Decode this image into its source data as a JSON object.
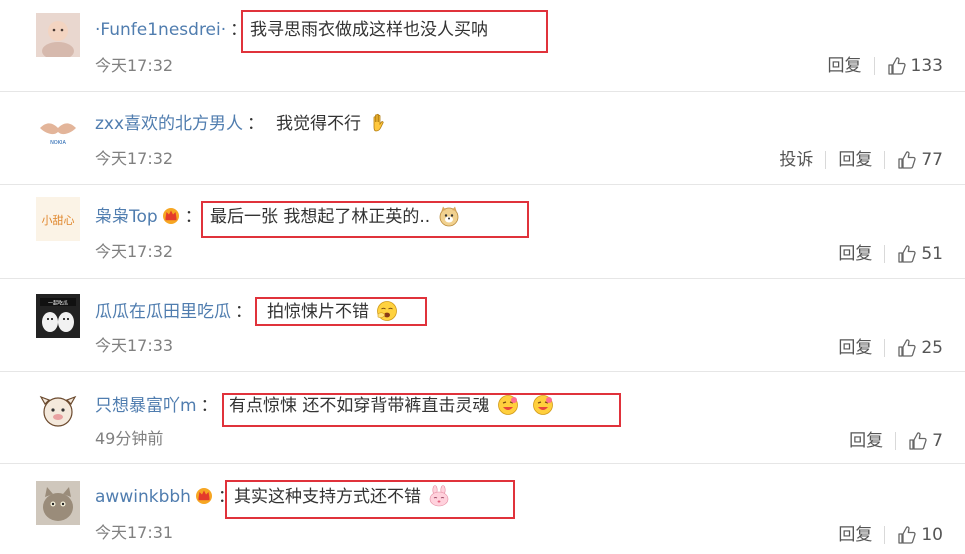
{
  "labels": {
    "reply": "回复",
    "report": "投诉",
    "colon": "："
  },
  "colors": {
    "username": "#507daf",
    "highlight": "#e0323b",
    "time": "#808080"
  },
  "comments": [
    {
      "username": "·Funfe1nesdrei·",
      "text": "我寻思雨衣做成这样也没人买呐",
      "time": "今天17:32",
      "likes": "133",
      "vip": false,
      "emojis": []
    },
    {
      "username": "zxx喜欢的北方男人",
      "text": "我觉得不行",
      "time": "今天17:32",
      "likes": "77",
      "vip": false,
      "emojis": [
        "raised-hand-emoji"
      ]
    },
    {
      "username": "枭枭Top",
      "text": "最后一张 我想起了林正英的..",
      "time": "今天17:32",
      "likes": "51",
      "vip": true,
      "emojis": [
        "doge-emoji"
      ]
    },
    {
      "username": "瓜瓜在瓜田里吃瓜",
      "text": "拍惊悚片不错",
      "time": "今天17:33",
      "likes": "25",
      "vip": false,
      "emojis": [
        "yawn-face-emoji"
      ]
    },
    {
      "username": "只想暴富吖m",
      "text": "有点惊悚 还不如穿背带裤直击灵魂",
      "time": "49分钟前",
      "likes": "7",
      "vip": false,
      "emojis": [
        "drooling-face-emoji",
        "drooling-face-emoji"
      ]
    },
    {
      "username": "awwinkbbh",
      "text": "其实这种支持方式还不错",
      "time": "今天17:31",
      "likes": "10",
      "vip": true,
      "emojis": [
        "pink-bunny-emoji"
      ]
    }
  ]
}
